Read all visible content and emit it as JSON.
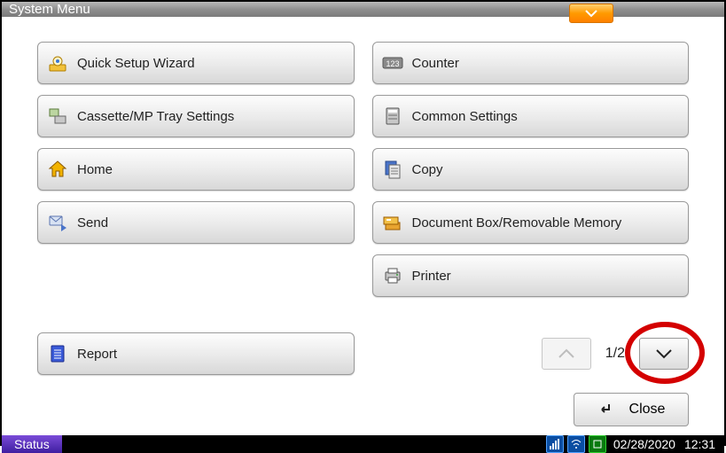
{
  "titlebar": {
    "title": "System Menu"
  },
  "menu": {
    "left": [
      {
        "label": "Quick Setup Wizard"
      },
      {
        "label": "Cassette/MP Tray Settings"
      },
      {
        "label": "Home"
      },
      {
        "label": "Send"
      }
    ],
    "right": [
      {
        "label": "Counter"
      },
      {
        "label": "Common Settings"
      },
      {
        "label": "Copy"
      },
      {
        "label": "Document Box/Removable Memory"
      },
      {
        "label": "Printer"
      }
    ],
    "report": {
      "label": "Report"
    }
  },
  "pager": {
    "indicator": "1/2"
  },
  "close": {
    "label": "Close"
  },
  "status": {
    "label": "Status",
    "date": "02/28/2020",
    "time": "12:31"
  }
}
